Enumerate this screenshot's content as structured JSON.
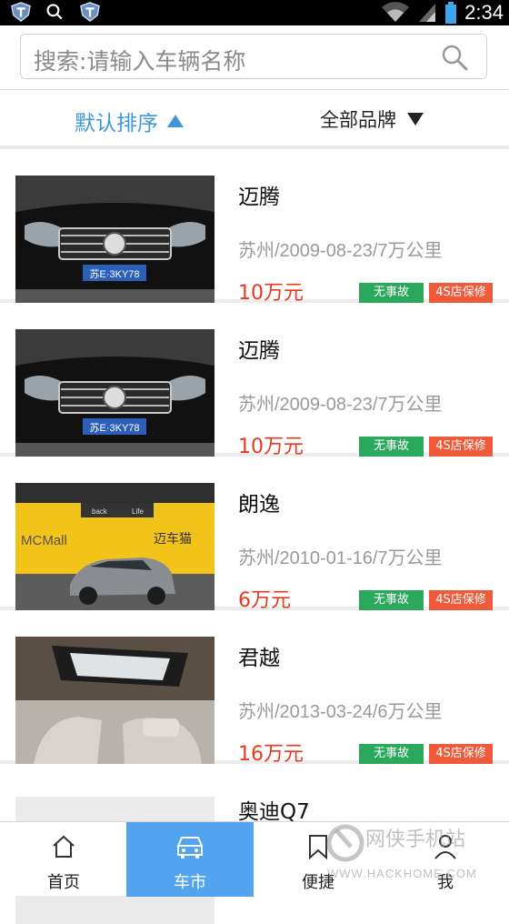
{
  "status_bar": {
    "time": "2:34"
  },
  "search": {
    "placeholder": "搜索:请输入车辆名称"
  },
  "sort_bar": {
    "default_sort": "默认排序",
    "all_brands": "全部品牌"
  },
  "listings": [
    {
      "name": "迈腾",
      "meta": "苏州/2009-08-23/7万公里",
      "price": "10万元",
      "tags": [
        "无事故",
        "4S店保修"
      ]
    },
    {
      "name": "迈腾",
      "meta": "苏州/2009-08-23/7万公里",
      "price": "10万元",
      "tags": [
        "无事故",
        "4S店保修"
      ]
    },
    {
      "name": "朗逸",
      "meta": "苏州/2010-01-16/7万公里",
      "price": "6万元",
      "tags": [
        "无事故",
        "4S店保修"
      ]
    },
    {
      "name": "君越",
      "meta": "苏州/2013-03-24/6万公里",
      "price": "16万元",
      "tags": [
        "无事故",
        "4S店保修"
      ]
    },
    {
      "name": "奥迪Q7"
    }
  ],
  "bottom_nav": [
    {
      "label": "首页",
      "icon": "home-icon"
    },
    {
      "label": "车市",
      "icon": "car-icon",
      "active": true
    },
    {
      "label": "便捷",
      "icon": "bookmark-icon"
    },
    {
      "label": "我",
      "icon": "person-icon"
    }
  ],
  "watermark": {
    "brand": "网侠手机站",
    "url": "WWW.HACKHOME.COM"
  },
  "photo_text": {
    "plate": "苏E·3KY78",
    "store_sign": "MCMall",
    "store_sign_cn": "迈车猫",
    "banner_left": "back",
    "banner_right": "Life"
  }
}
